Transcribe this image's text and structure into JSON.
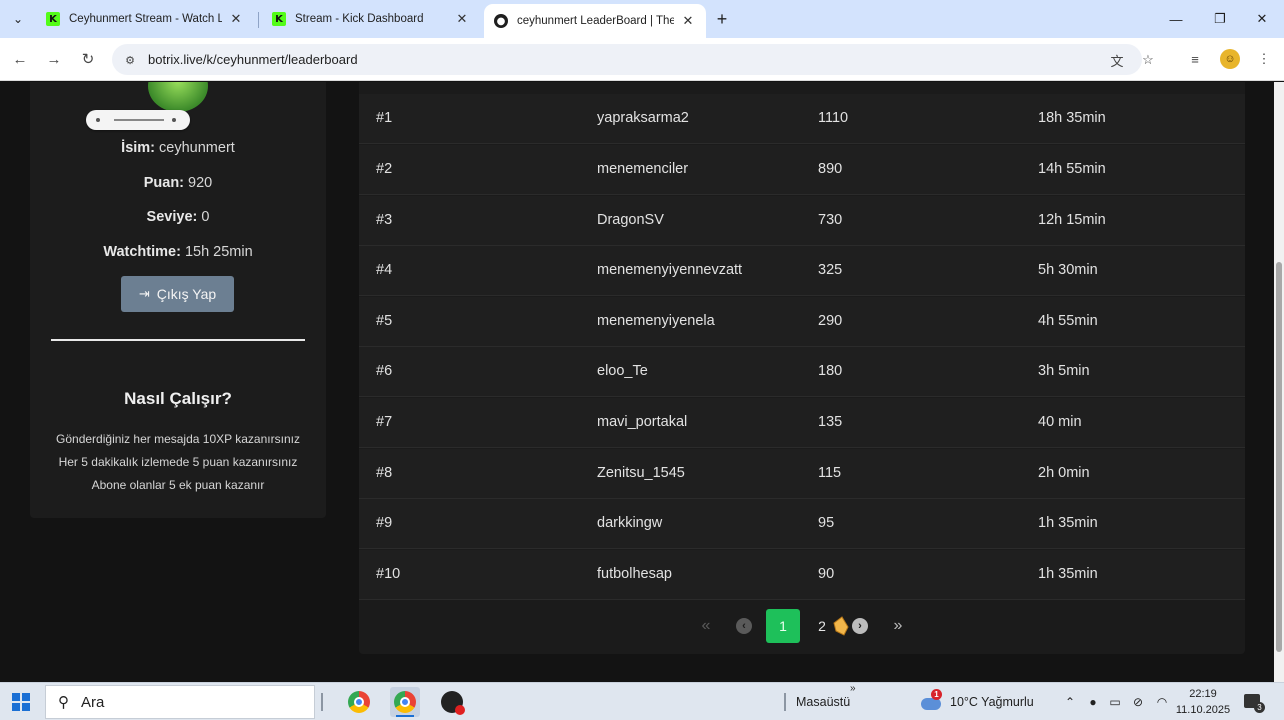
{
  "browser": {
    "tabs": [
      {
        "title": "Ceyhunmert Stream - Watch Live",
        "favicon": "kick-logo-icon",
        "active": false
      },
      {
        "title": "Stream - Kick Dashboard",
        "favicon": "kick-logo-icon",
        "active": false
      },
      {
        "title": "ceyhunmert LeaderBoard | The",
        "favicon": "botrix-logo-icon",
        "active": true
      }
    ],
    "url": "botrix.live/k/ceyhunmert/leaderboard"
  },
  "profile": {
    "isim_label": "İsim:",
    "isim_value": "ceyhunmert",
    "puan_label": "Puan:",
    "puan_value": "920",
    "seviye_label": "Seviye:",
    "seviye_value": "0",
    "watchtime_label": "Watchtime:",
    "watchtime_value": "15h 25min",
    "logout_label": "Çıkış Yap"
  },
  "how_it_works": {
    "title": "Nasıl Çalışır?",
    "lines": [
      "Gönderdiğiniz her mesajda 10XP kazanırsınız",
      "Her 5 dakikalık izlemede 5 puan kazanırsınız",
      "Abone olanlar 5 ek puan kazanır"
    ]
  },
  "leaderboard": {
    "rows": [
      {
        "rank": "#1",
        "name": "yapraksarma2",
        "points": "1110",
        "watchtime": "18h 35min"
      },
      {
        "rank": "#2",
        "name": "menemenciler",
        "points": "890",
        "watchtime": "14h 55min"
      },
      {
        "rank": "#3",
        "name": "DragonSV",
        "points": "730",
        "watchtime": "12h 15min"
      },
      {
        "rank": "#4",
        "name": "menemenyiyennevzatt",
        "points": "325",
        "watchtime": "5h 30min"
      },
      {
        "rank": "#5",
        "name": "menemenyiyenela",
        "points": "290",
        "watchtime": "4h 55min"
      },
      {
        "rank": "#6",
        "name": "eloo_Te",
        "points": "180",
        "watchtime": "3h 5min"
      },
      {
        "rank": "#7",
        "name": "mavi_portakal",
        "points": "135",
        "watchtime": "40 min"
      },
      {
        "rank": "#8",
        "name": "Zenitsu_1545",
        "points": "115",
        "watchtime": "2h 0min"
      },
      {
        "rank": "#9",
        "name": "darkkingw",
        "points": "95",
        "watchtime": "1h 35min"
      },
      {
        "rank": "#10",
        "name": "futbolhesap",
        "points": "90",
        "watchtime": "1h 35min"
      }
    ],
    "pagination": {
      "first": "«",
      "prev": "‹",
      "current": "1",
      "next_page": "2",
      "next": "›",
      "last": "»"
    }
  },
  "taskbar": {
    "search_label": "Ara",
    "desktop_label": "Masaüstü",
    "weather": "10°C  Yağmurlu",
    "weather_badge": "1",
    "time": "22:19",
    "date": "11.10.2025",
    "notification_count": "3"
  },
  "colors": {
    "accent_green": "#1ec05a",
    "logout_button": "#6c7f92",
    "page_background": "#131313",
    "card_background": "#1f1f1f"
  }
}
